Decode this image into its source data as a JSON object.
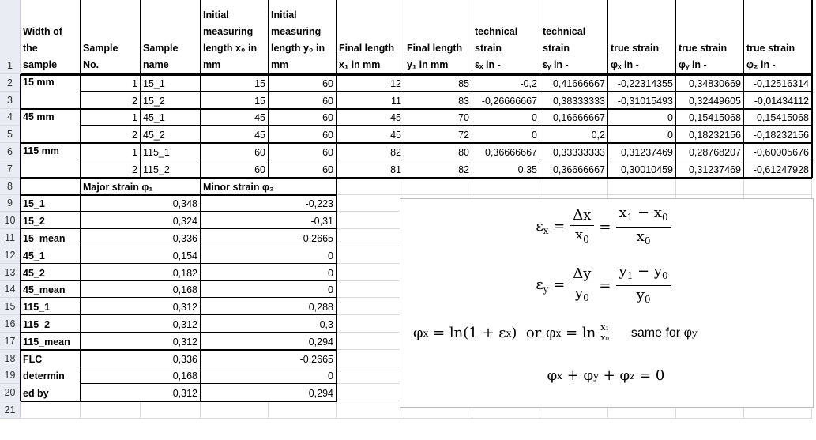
{
  "row_numbers": [
    "1",
    "2",
    "3",
    "4",
    "5",
    "6",
    "7",
    "8",
    "9",
    "10",
    "11",
    "12",
    "13",
    "14",
    "15",
    "16",
    "17",
    "18",
    "19",
    "20",
    "21"
  ],
  "header": {
    "width": [
      "Width of",
      "the",
      "sample"
    ],
    "sample_no": [
      "Sample",
      "No."
    ],
    "sample_name": [
      "Sample",
      "name"
    ],
    "init_x": [
      "Initial",
      "measuring",
      "length x₀ in",
      "mm"
    ],
    "init_y": [
      "Initial",
      "measuring",
      "length y₀ in",
      "mm"
    ],
    "final_x": [
      "Final length",
      "x₁ in mm"
    ],
    "final_y": [
      "Final length",
      "y₁ in mm"
    ],
    "tech_x": [
      "technical",
      "strain",
      "εₓ in -"
    ],
    "tech_y": [
      "technical",
      "strain",
      "εᵧ in -"
    ],
    "true_x": [
      "true strain",
      "φₓ in -"
    ],
    "true_y": [
      "true strain",
      "φᵧ in -"
    ],
    "true_z": [
      "true strain",
      "φ₂ in -"
    ]
  },
  "width_groups": [
    "15 mm",
    "45 mm",
    "115 mm"
  ],
  "rows": [
    {
      "no": "1",
      "name": "15_1",
      "x0": "15",
      "y0": "60",
      "x1": "12",
      "y1": "85",
      "ex": "-0,2",
      "ey": "0,41666667",
      "px": "-0,22314355",
      "py": "0,34830669",
      "pz": "-0,12516314"
    },
    {
      "no": "2",
      "name": "15_2",
      "x0": "15",
      "y0": "60",
      "x1": "11",
      "y1": "83",
      "ex": "-0,26666667",
      "ey": "0,38333333",
      "px": "-0,31015493",
      "py": "0,32449605",
      "pz": "-0,01434112"
    },
    {
      "no": "1",
      "name": "45_1",
      "x0": "45",
      "y0": "60",
      "x1": "45",
      "y1": "70",
      "ex": "0",
      "ey": "0,16666667",
      "px": "0",
      "py": "0,15415068",
      "pz": "-0,15415068"
    },
    {
      "no": "2",
      "name": "45_2",
      "x0": "45",
      "y0": "60",
      "x1": "45",
      "y1": "72",
      "ex": "0",
      "ey": "0,2",
      "px": "0",
      "py": "0,18232156",
      "pz": "-0,18232156"
    },
    {
      "no": "1",
      "name": "115_1",
      "x0": "60",
      "y0": "60",
      "x1": "82",
      "y1": "80",
      "ex": "0,36666667",
      "ey": "0,33333333",
      "px": "0,31237469",
      "py": "0,28768207",
      "pz": "-0,60005676"
    },
    {
      "no": "2",
      "name": "115_2",
      "x0": "60",
      "y0": "60",
      "x1": "81",
      "y1": "82",
      "ex": "0,35",
      "ey": "0,36666667",
      "px": "0,30010459",
      "py": "0,31237469",
      "pz": "-0,61247928"
    }
  ],
  "summary": {
    "major_label": "Major strain φ₁",
    "minor_label": "Minor strain φ₂",
    "rows": [
      {
        "label": "15_1",
        "major": "0,348",
        "minor": "-0,223"
      },
      {
        "label": "15_2",
        "major": "0,324",
        "minor": "-0,31"
      },
      {
        "label": "15_mean",
        "major": "0,336",
        "minor": "-0,2665"
      },
      {
        "label": "45_1",
        "major": "0,154",
        "minor": "0"
      },
      {
        "label": "45_2",
        "major": "0,182",
        "minor": "0"
      },
      {
        "label": "45_mean",
        "major": "0,168",
        "minor": "0"
      },
      {
        "label": "115_1",
        "major": "0,312",
        "minor": "0,288"
      },
      {
        "label": "115_2",
        "major": "0,312",
        "minor": "0,3"
      },
      {
        "label": "115_mean",
        "major": "0,312",
        "minor": "0,294"
      },
      {
        "label": "FLC",
        "major": "0,336",
        "minor": "-0,2665"
      },
      {
        "label": "determin",
        "major": "0,168",
        "minor": "0"
      },
      {
        "label": "ed by",
        "major": "0,312",
        "minor": "0,294"
      }
    ]
  },
  "formulas": {
    "eps_x": {
      "lhs": "ε",
      "lhs_sub": "x",
      "num1": "Δx",
      "den1": "x",
      "den1_sub": "0",
      "num2": "x",
      "num2_sub1": "1",
      "num2_mid": " − x",
      "num2_sub2": "0",
      "den2": "x",
      "den2_sub": "0"
    },
    "eps_y": {
      "lhs": "ε",
      "lhs_sub": "y",
      "num1": "Δy",
      "den1": "y",
      "den1_sub": "0",
      "num2": "y",
      "num2_sub1": "1",
      "num2_mid": " − y",
      "num2_sub2": "0",
      "den2": "y",
      "den2_sub": "0"
    },
    "phi_x": {
      "part1": "φ",
      "part1_sub": "x",
      "part2": " = ln(1 + ε",
      "part2_sub": "x",
      "part3": ")  or φ",
      "part3_sub": "x",
      "part4": " = ln",
      "frac_num": "x₁",
      "frac_den": "x₀",
      "same_for": "same for φ",
      "same_for_sub": "y"
    },
    "sum": {
      "a": "φ",
      "a_sub": "x",
      "b": " + φ",
      "b_sub": "y",
      "c": " + φ",
      "c_sub": "z",
      "d": " = 0"
    }
  }
}
